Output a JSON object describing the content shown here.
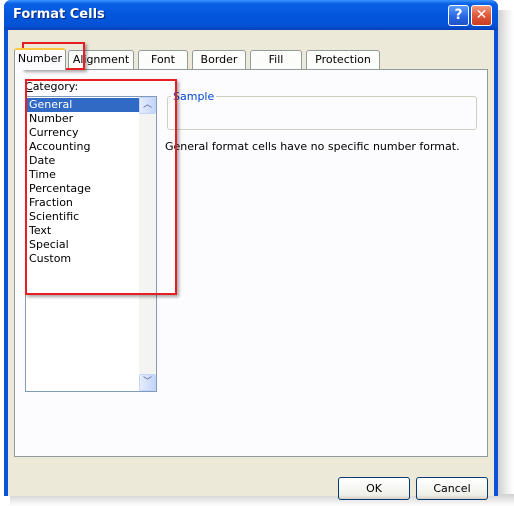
{
  "window": {
    "title": "Format Cells",
    "help_glyph": "?",
    "close_glyph": "✕"
  },
  "tabs": [
    {
      "label": "Number"
    },
    {
      "label": "Alignment"
    },
    {
      "label": "Font"
    },
    {
      "label": "Border"
    },
    {
      "label": "Fill"
    },
    {
      "label": "Protection"
    }
  ],
  "category": {
    "label_accel": "C",
    "label_rest": "ategory:",
    "items": [
      "General",
      "Number",
      "Currency",
      "Accounting",
      "Date",
      "Time",
      "Percentage",
      "Fraction",
      "Scientific",
      "Text",
      "Special",
      "Custom"
    ],
    "selected": "General"
  },
  "sample": {
    "legend": "Sample"
  },
  "description": "General format cells have no specific number format.",
  "buttons": {
    "ok": "OK",
    "cancel": "Cancel"
  },
  "scroll": {
    "up_glyph": "︿",
    "down_glyph": "﹀"
  },
  "colors": {
    "highlight_box": "#e81e25",
    "selection": "#316ac5",
    "titlebar": "#0355dc"
  }
}
